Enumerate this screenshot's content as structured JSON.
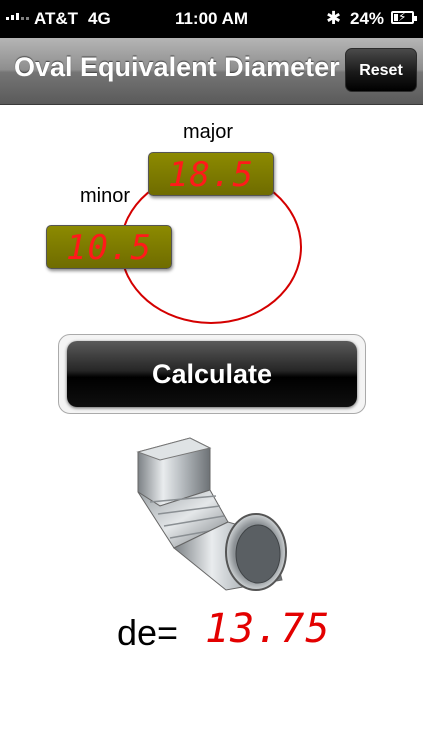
{
  "status_bar": {
    "carrier": "AT&T",
    "network": "4G",
    "time": "11:00 AM",
    "battery_percent": "24%",
    "battery_level": 0.24
  },
  "nav": {
    "title": "Oval Equivalent Diameter",
    "reset_label": "Reset"
  },
  "inputs": {
    "major_label": "major",
    "major_value": "18.5",
    "minor_label": "minor",
    "minor_value": "10.5"
  },
  "calculate_label": "Calculate",
  "result": {
    "label": "de=",
    "value": "13.75"
  },
  "colors": {
    "accent_red": "#e30000",
    "lcd_background": "#7d7b00",
    "oval_stroke": "#d40000"
  },
  "icons": {
    "bluetooth": "bluetooth-icon",
    "battery": "battery-icon",
    "duct": "duct-elbow-image"
  }
}
